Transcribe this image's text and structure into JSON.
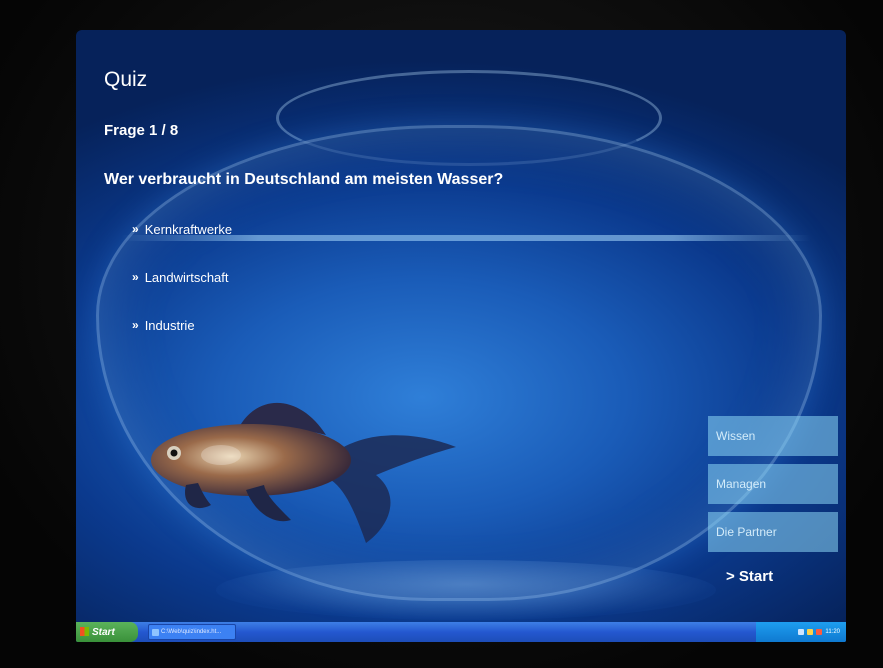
{
  "quiz": {
    "title": "Quiz",
    "progress": "Frage 1 / 8",
    "question": "Wer verbraucht in Deutschland am meisten Wasser?",
    "answers": [
      {
        "bullet": "»",
        "label": "Kernkraftwerke"
      },
      {
        "bullet": "»",
        "label": "Landwirtschaft"
      },
      {
        "bullet": "»",
        "label": "Industrie"
      }
    ]
  },
  "side_nav": {
    "items": [
      "Wissen",
      "Managen",
      "Die Partner"
    ],
    "start_label": "> Start"
  },
  "taskbar": {
    "start_label": "Start",
    "task_label": "C:\\Web\\quiz\\index.ht...",
    "clock": "11:20"
  },
  "colors": {
    "nav_button_bg": "#8cd7f5",
    "screen_blue": "#1a5cb8",
    "taskbar_blue": "#2458d0"
  }
}
